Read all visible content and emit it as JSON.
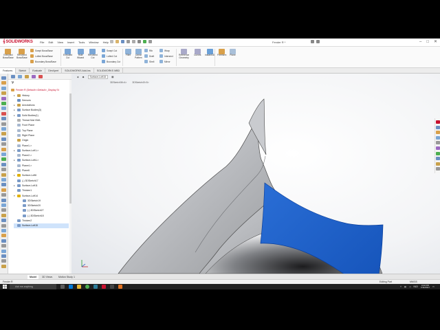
{
  "app": {
    "logo_text": "SOLIDWORKS",
    "menus": [
      "File",
      "Edit",
      "View",
      "Insert",
      "Tools",
      "Window",
      "Help"
    ],
    "document_title": "Fender R *",
    "window_controls": [
      "–",
      "□",
      "✕"
    ]
  },
  "ribbon": {
    "large_buttons": [
      {
        "label": "Extruded\nBoss/Base",
        "color": "#d9a04a"
      },
      {
        "label": "Revolved\nBoss/Base",
        "color": "#d9a04a"
      },
      {
        "label": "Extruded\nCut",
        "color": "#7aa6d6"
      },
      {
        "label": "Hole\nWizard",
        "color": "#7aa6d6"
      },
      {
        "label": "Revolved\nCut",
        "color": "#7aa6d6"
      },
      {
        "label": "Fillet",
        "color": "#8fb3d9"
      },
      {
        "label": "Linear\nPattern",
        "color": "#8fb3d9"
      },
      {
        "label": "Reference\nGeometry",
        "color": "#a9a9c9"
      },
      {
        "label": "Curves",
        "color": "#a9a9c9"
      },
      {
        "label": "Instant3D",
        "color": "#6aa0d8"
      },
      {
        "label": "Freeform",
        "color": "#d9a04a"
      },
      {
        "label": "Plane",
        "color": "#a9c0d9"
      }
    ],
    "small_buttons": [
      {
        "label": "Swept Boss/Base",
        "color": "#d9a04a"
      },
      {
        "label": "Lofted Boss/Base",
        "color": "#d9a04a"
      },
      {
        "label": "Boundary Boss/Base",
        "color": "#d9a04a"
      },
      {
        "label": "Swept Cut",
        "color": "#7aa6d6"
      },
      {
        "label": "Lofted Cut",
        "color": "#7aa6d6"
      },
      {
        "label": "Boundary Cut",
        "color": "#7aa6d6"
      },
      {
        "label": "Rib",
        "color": "#8fb3d9"
      },
      {
        "label": "Draft",
        "color": "#8fb3d9"
      },
      {
        "label": "Shell",
        "color": "#8fb3d9"
      },
      {
        "label": "Wrap",
        "color": "#8fb3d9"
      },
      {
        "label": "Intersect",
        "color": "#8fb3d9"
      },
      {
        "label": "Mirror",
        "color": "#8fb3d9"
      }
    ]
  },
  "command_tabs": [
    "Features",
    "Sketch",
    "Evaluate",
    "DimXpert",
    "SOLIDWORKS Add-Ins",
    "SOLIDWORKS MBD"
  ],
  "active_command_tab": "Features",
  "feature_tree": {
    "root": "Fender R  (Default<<Default>_Display St",
    "items": [
      {
        "label": "History",
        "indent": 1,
        "exp": "▸",
        "color": "#c9a14a"
      },
      {
        "label": "Sensors",
        "indent": 1,
        "exp": "",
        "color": "#6a8fc2"
      },
      {
        "label": "Annotations",
        "indent": 1,
        "exp": "▸",
        "color": "#c9a14a"
      },
      {
        "label": "Surface Bodies(3)",
        "indent": 1,
        "exp": "▸",
        "color": "#7a9ac7"
      },
      {
        "label": "Solid Bodies(1)",
        "indent": 1,
        "exp": "▸",
        "color": "#7a9ac7"
      },
      {
        "label": "Thread Mat VMA",
        "indent": 1,
        "exp": "",
        "color": "#b0b0b0"
      },
      {
        "label": "Front Plane",
        "indent": 1,
        "exp": "",
        "color": "#a7b8cf"
      },
      {
        "label": "Top Plane",
        "indent": 1,
        "exp": "",
        "color": "#a7b8cf"
      },
      {
        "label": "Right Plane",
        "indent": 1,
        "exp": "",
        "color": "#a7b8cf"
      },
      {
        "label": "Origin",
        "indent": 1,
        "exp": "",
        "color": "#c9a14a"
      },
      {
        "label": "Plane1->",
        "indent": 1,
        "exp": "",
        "color": "#a7b8cf"
      },
      {
        "label": "Surface-Loft1->",
        "indent": 1,
        "exp": "▸",
        "color": "#7a9ac7"
      },
      {
        "label": "Plane2->",
        "indent": 1,
        "exp": "",
        "color": "#a7b8cf"
      },
      {
        "label": "Surface-Loft4->",
        "indent": 1,
        "exp": "▸",
        "color": "#7a9ac7"
      },
      {
        "label": "Plane4->",
        "indent": 1,
        "exp": "",
        "color": "#a7b8cf"
      },
      {
        "label": "Plane6",
        "indent": 1,
        "exp": "",
        "color": "#a7b8cf"
      },
      {
        "label": "Surface-Loft6",
        "indent": 1,
        "exp": "▸",
        "color": "#e0b000"
      },
      {
        "label": "(-) 3DSketch17",
        "indent": 1,
        "exp": "",
        "color": "#7a9ac7"
      },
      {
        "label": "Surface-Loft11",
        "indent": 1,
        "exp": "▸",
        "color": "#7a9ac7"
      },
      {
        "label": "Thicken1",
        "indent": 1,
        "exp": "",
        "color": "#7a9ac7"
      },
      {
        "label": "Surface-Loft14",
        "indent": 1,
        "exp": "▾",
        "color": "#e0b000"
      },
      {
        "label": "3DSketch19",
        "indent": 2,
        "exp": "",
        "color": "#7a9ac7"
      },
      {
        "label": "3DSketch20",
        "indent": 2,
        "exp": "",
        "color": "#7a9ac7"
      },
      {
        "label": "(-) 3DSketch27",
        "indent": 2,
        "exp": "",
        "color": "#7a9ac7"
      },
      {
        "label": "(-) 3DSketch18",
        "indent": 2,
        "exp": "",
        "color": "#7a9ac7"
      },
      {
        "label": "Thicken2",
        "indent": 1,
        "exp": "",
        "color": "#7a9ac7"
      },
      {
        "label": "Surface-Loft15",
        "indent": 1,
        "exp": "",
        "color": "#7a9ac7",
        "selected": true
      }
    ]
  },
  "viewport": {
    "breadcrumb": "Surface-Loft15",
    "sub_items": [
      "3DSketch36<4>",
      "3DSketch40<5>"
    ],
    "surface_color": "#1b5fc6",
    "body_color": "#c4c6ca"
  },
  "bottom_tabs": [
    "Model",
    "3D Views",
    "Motion Study 1"
  ],
  "active_bottom_tab": "Model",
  "status": {
    "left": "Fender R",
    "editing": "Editing Part",
    "units": "MMGS"
  },
  "taskbar": {
    "search_placeholder": "Ask me anything",
    "language": "NLD",
    "time": "3:22 PM",
    "date": "7/11/2017"
  }
}
